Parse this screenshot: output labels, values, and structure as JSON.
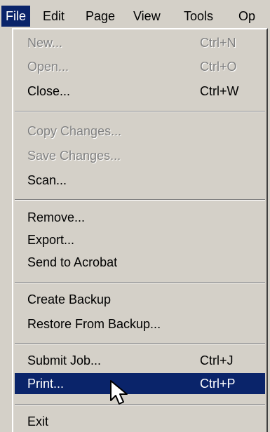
{
  "menubar": {
    "items": [
      {
        "label": "File",
        "active": true
      },
      {
        "label": "Edit"
      },
      {
        "label": "Page"
      },
      {
        "label": "View"
      },
      {
        "label": "Tools"
      },
      {
        "label": "Op"
      }
    ]
  },
  "menu": {
    "items": [
      {
        "label": "New...",
        "shortcut": "Ctrl+N",
        "state": "disabled"
      },
      {
        "label": "Open...",
        "shortcut": "Ctrl+O",
        "state": "disabled"
      },
      {
        "label": "Close...",
        "shortcut": "Ctrl+W",
        "state": "enabled"
      },
      {
        "label": "Copy Changes...",
        "state": "disabled"
      },
      {
        "label": "Save Changes...",
        "state": "disabled"
      },
      {
        "label": "Scan...",
        "state": "enabled"
      },
      {
        "label": "Remove...",
        "state": "enabled"
      },
      {
        "label": "Export...",
        "state": "enabled"
      },
      {
        "label": "Send to Acrobat",
        "state": "enabled"
      },
      {
        "label": "Create Backup",
        "state": "enabled"
      },
      {
        "label": "Restore From Backup...",
        "state": "enabled"
      },
      {
        "label": "Submit Job...",
        "shortcut": "Ctrl+J",
        "state": "enabled"
      },
      {
        "label": "Print...",
        "shortcut": "Ctrl+P",
        "state": "selected"
      },
      {
        "label": "Exit",
        "state": "enabled"
      }
    ]
  },
  "colors": {
    "menu_background": "#d4d0c8",
    "highlight": "#0a246a",
    "disabled_text": "#808080"
  },
  "icons": {
    "cursor": "mouse-pointer-icon"
  }
}
